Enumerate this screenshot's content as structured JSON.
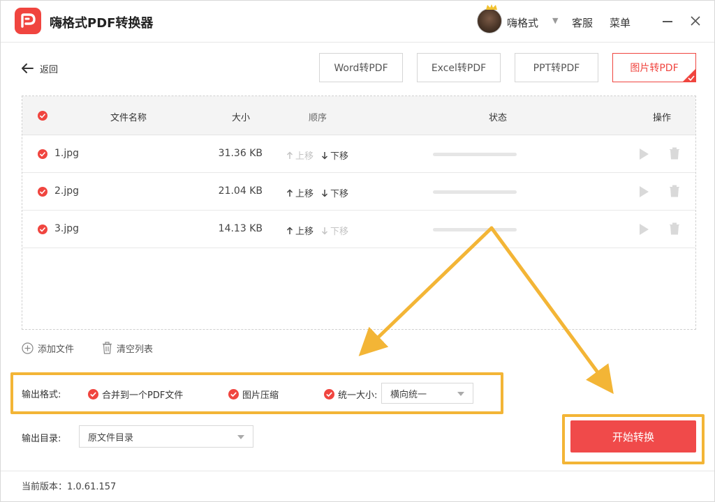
{
  "app": {
    "title": "嗨格式PDF转换器"
  },
  "header": {
    "username": "嗨格式",
    "service": "客服",
    "menu": "菜单"
  },
  "nav": {
    "back": "返回"
  },
  "tabs": [
    {
      "label": "Word转PDF",
      "active": false
    },
    {
      "label": "Excel转PDF",
      "active": false
    },
    {
      "label": "PPT转PDF",
      "active": false
    },
    {
      "label": "图片转PDF",
      "active": true
    }
  ],
  "table": {
    "headers": {
      "name": "文件名称",
      "size": "大小",
      "order": "顺序",
      "status": "状态",
      "actions": "操作"
    },
    "move_up": "上移",
    "move_down": "下移",
    "rows": [
      {
        "name": "1.jpg",
        "size": "31.36 KB",
        "up_enabled": false,
        "down_enabled": true
      },
      {
        "name": "2.jpg",
        "size": "21.04 KB",
        "up_enabled": true,
        "down_enabled": true
      },
      {
        "name": "3.jpg",
        "size": "14.13 KB",
        "up_enabled": true,
        "down_enabled": false
      }
    ]
  },
  "actions": {
    "add_file": "添加文件",
    "clear_list": "清空列表"
  },
  "output": {
    "format_label": "输出格式:",
    "merge": "合并到一个PDF文件",
    "compress": "图片压缩",
    "unify_size": "统一大小:",
    "unify_value": "横向统一",
    "dir_label": "输出目录:",
    "dir_value": "原文件目录"
  },
  "start_button": "开始转换",
  "footer": {
    "version": "当前版本：1.0.61.157"
  },
  "colors": {
    "accent": "#f0453f",
    "highlight": "#f3b536"
  }
}
